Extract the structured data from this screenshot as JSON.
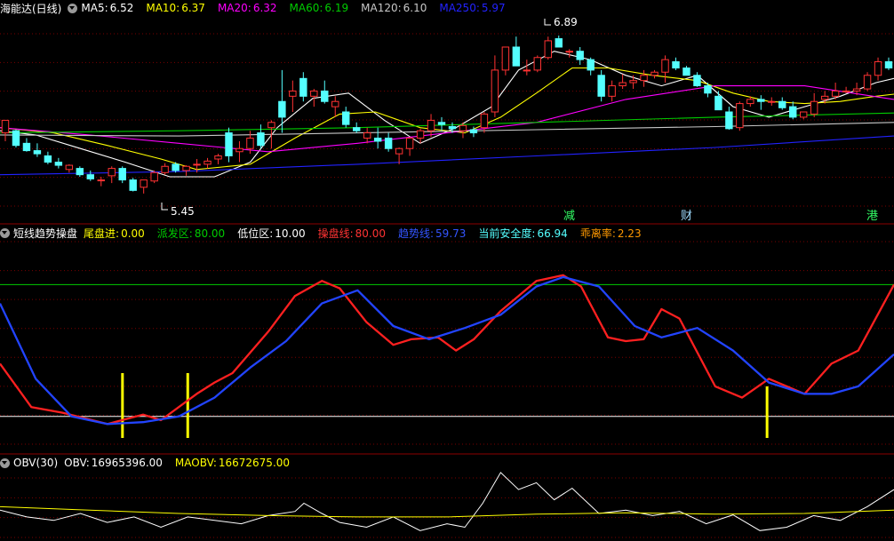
{
  "colors": {
    "white": "#ffffff",
    "yellow": "#ffff00",
    "magenta": "#ff00ff",
    "green": "#00cc00",
    "grey": "#c8c8c8",
    "blue": "#2222ff",
    "up": "#ff3232",
    "down": "#54ffff",
    "red": "#ff2020",
    "trend": "#2244ff",
    "divider": "#8b0000",
    "grid": "#7a0000"
  },
  "panel1": {
    "stock": "海能达(日线)",
    "ma": [
      {
        "label": "MA5:",
        "value": "6.52",
        "color": "#ffffff"
      },
      {
        "label": "MA10:",
        "value": "6.37",
        "color": "#ffff00"
      },
      {
        "label": "MA20:",
        "value": "6.32",
        "color": "#ff00ff"
      },
      {
        "label": "MA60:",
        "value": "6.19",
        "color": "#00cc00"
      },
      {
        "label": "MA120:",
        "value": "6.10",
        "color": "#c8c8c8"
      },
      {
        "label": "MA250:",
        "value": "5.97",
        "color": "#2222ff"
      }
    ],
    "high_label": "6.89",
    "low_label": "5.45",
    "events": [
      {
        "text": "减",
        "color": "#ffffff",
        "bg": "#00aa33"
      },
      {
        "text": "财",
        "color": "#ffffff",
        "bg": "#0044cc"
      },
      {
        "text": "港",
        "color": "#000000",
        "bg": "#00cc33"
      }
    ]
  },
  "panel2": {
    "title": "短线趋势操盘",
    "items": [
      {
        "label": "尾盘进:",
        "value": "0.00",
        "color": "#ffff00"
      },
      {
        "label": "派发区:",
        "value": "80.00",
        "color": "#00cc00"
      },
      {
        "label": "低位区:",
        "value": "10.00",
        "color": "#ffffff"
      },
      {
        "label": "操盘线:",
        "value": "80.00",
        "color": "#ff3333"
      },
      {
        "label": "趋势线:",
        "value": "59.73",
        "color": "#3355ff"
      },
      {
        "label": "当前安全度:",
        "value": "66.94",
        "color": "#54ffff"
      },
      {
        "label": "乖离率:",
        "value": "2.23",
        "color": "#ff9900"
      }
    ]
  },
  "panel3": {
    "title": "OBV(30)",
    "items": [
      {
        "label": "OBV:",
        "value": "16965396.00",
        "color": "#ffffff"
      },
      {
        "label": "MAOBV:",
        "value": "16672675.00",
        "color": "#ffff00"
      }
    ]
  },
  "chart_data": [
    {
      "type": "candlestick",
      "title": "海能达(日线)",
      "ylim": [
        5.3,
        7.1
      ],
      "candles": [
        [
          6.0,
          6.12,
          5.92,
          6.12
        ],
        [
          6.02,
          6.03,
          5.86,
          5.88
        ],
        [
          5.9,
          5.95,
          5.82,
          5.83
        ],
        [
          5.83,
          5.9,
          5.77,
          5.8
        ],
        [
          5.78,
          5.82,
          5.7,
          5.72
        ],
        [
          5.72,
          5.76,
          5.66,
          5.69
        ],
        [
          5.65,
          5.7,
          5.62,
          5.69
        ],
        [
          5.66,
          5.68,
          5.58,
          5.6
        ],
        [
          5.6,
          5.64,
          5.54,
          5.56
        ],
        [
          5.55,
          5.58,
          5.49,
          5.55
        ],
        [
          5.59,
          5.68,
          5.52,
          5.66
        ],
        [
          5.66,
          5.68,
          5.52,
          5.55
        ],
        [
          5.55,
          5.57,
          5.44,
          5.45
        ],
        [
          5.48,
          5.55,
          5.42,
          5.55
        ],
        [
          5.54,
          5.64,
          5.52,
          5.62
        ],
        [
          5.62,
          5.71,
          5.6,
          5.68
        ],
        [
          5.7,
          5.72,
          5.62,
          5.64
        ],
        [
          5.64,
          5.69,
          5.59,
          5.68
        ],
        [
          5.7,
          5.75,
          5.62,
          5.7
        ],
        [
          5.7,
          5.76,
          5.66,
          5.73
        ],
        [
          5.75,
          5.8,
          5.7,
          5.78
        ],
        [
          6.0,
          6.05,
          5.72,
          5.78
        ],
        [
          5.82,
          5.92,
          5.72,
          5.85
        ],
        [
          5.85,
          6.02,
          5.8,
          5.95
        ],
        [
          6.0,
          6.08,
          5.85,
          5.88
        ],
        [
          6.05,
          6.12,
          5.85,
          6.1
        ],
        [
          6.3,
          6.6,
          6.0,
          6.15
        ],
        [
          6.35,
          6.5,
          6.2,
          6.4
        ],
        [
          6.52,
          6.58,
          6.3,
          6.35
        ],
        [
          6.35,
          6.42,
          6.25,
          6.4
        ],
        [
          6.4,
          6.5,
          6.28,
          6.3
        ],
        [
          6.25,
          6.35,
          6.15,
          6.3
        ],
        [
          6.2,
          6.25,
          6.05,
          6.08
        ],
        [
          6.05,
          6.1,
          6.0,
          6.02
        ],
        [
          5.95,
          6.05,
          5.9,
          6.0
        ],
        [
          5.95,
          6.05,
          5.85,
          5.92
        ],
        [
          5.95,
          6.0,
          5.82,
          5.85
        ],
        [
          5.8,
          5.86,
          5.7,
          5.85
        ],
        [
          5.85,
          5.96,
          5.78,
          5.95
        ],
        [
          5.95,
          6.04,
          5.9,
          6.02
        ],
        [
          6.02,
          6.18,
          5.96,
          6.12
        ],
        [
          6.1,
          6.15,
          6.02,
          6.08
        ],
        [
          6.06,
          6.1,
          6.0,
          6.04
        ],
        [
          6.02,
          6.1,
          5.95,
          6.07
        ],
        [
          6.03,
          6.06,
          5.96,
          6.0
        ],
        [
          6.05,
          6.2,
          6.0,
          6.18
        ],
        [
          6.2,
          6.74,
          6.15,
          6.6
        ],
        [
          6.6,
          6.82,
          6.55,
          6.82
        ],
        [
          6.82,
          6.92,
          6.64,
          6.64
        ],
        [
          6.6,
          6.7,
          6.55,
          6.6
        ],
        [
          6.6,
          6.74,
          6.58,
          6.72
        ],
        [
          6.72,
          6.92,
          6.7,
          6.88
        ],
        [
          6.9,
          6.93,
          6.82,
          6.82
        ],
        [
          6.78,
          6.8,
          6.72,
          6.78
        ],
        [
          6.78,
          6.82,
          6.65,
          6.7
        ],
        [
          6.7,
          6.72,
          6.55,
          6.6
        ],
        [
          6.55,
          6.6,
          6.3,
          6.35
        ],
        [
          6.35,
          6.5,
          6.3,
          6.45
        ],
        [
          6.45,
          6.56,
          6.42,
          6.48
        ],
        [
          6.48,
          6.55,
          6.42,
          6.5
        ],
        [
          6.5,
          6.6,
          6.44,
          6.55
        ],
        [
          6.55,
          6.6,
          6.52,
          6.58
        ],
        [
          6.58,
          6.74,
          6.48,
          6.7
        ],
        [
          6.68,
          6.72,
          6.6,
          6.62
        ],
        [
          6.62,
          6.64,
          6.55,
          6.55
        ],
        [
          6.55,
          6.58,
          6.44,
          6.45
        ],
        [
          6.45,
          6.48,
          6.34,
          6.38
        ],
        [
          6.35,
          6.4,
          6.22,
          6.22
        ],
        [
          6.2,
          6.25,
          6.03,
          6.04
        ],
        [
          6.05,
          6.3,
          6.02,
          6.28
        ],
        [
          6.28,
          6.35,
          6.25,
          6.32
        ],
        [
          6.32,
          6.36,
          6.22,
          6.3
        ],
        [
          6.3,
          6.34,
          6.26,
          6.3
        ],
        [
          6.3,
          6.34,
          6.22,
          6.24
        ],
        [
          6.25,
          6.3,
          6.13,
          6.15
        ],
        [
          6.15,
          6.2,
          6.13,
          6.2
        ],
        [
          6.18,
          6.38,
          6.15,
          6.3
        ],
        [
          6.32,
          6.4,
          6.28,
          6.35
        ],
        [
          6.35,
          6.48,
          6.32,
          6.4
        ],
        [
          6.4,
          6.44,
          6.38,
          6.4
        ],
        [
          6.4,
          6.48,
          6.36,
          6.42
        ],
        [
          6.42,
          6.58,
          6.4,
          6.55
        ],
        [
          6.55,
          6.72,
          6.5,
          6.68
        ],
        [
          6.68,
          6.72,
          6.6,
          6.62
        ]
      ],
      "ma_series": [
        {
          "name": "MA5",
          "color": "#ffffff",
          "x": [
            0,
            0.04,
            0.09,
            0.14,
            0.19,
            0.24,
            0.28,
            0.31,
            0.35,
            0.39,
            0.43,
            0.47,
            0.51,
            0.55,
            0.58,
            0.62,
            0.66,
            0.7,
            0.74,
            0.78,
            0.82,
            0.86,
            0.9,
            0.94,
            0.98,
            1.0
          ],
          "y": [
            6.02,
            5.98,
            5.85,
            5.72,
            5.58,
            5.58,
            5.72,
            6.05,
            6.33,
            6.38,
            6.12,
            5.9,
            6.05,
            6.25,
            6.6,
            6.78,
            6.7,
            6.55,
            6.45,
            6.55,
            6.25,
            6.15,
            6.25,
            6.35,
            6.48,
            6.52
          ]
        },
        {
          "name": "MA10",
          "color": "#ffff00",
          "x": [
            0,
            0.06,
            0.12,
            0.18,
            0.22,
            0.28,
            0.33,
            0.38,
            0.42,
            0.47,
            0.52,
            0.56,
            0.6,
            0.64,
            0.68,
            0.73,
            0.78,
            0.82,
            0.86,
            0.9,
            0.94,
            0.98,
            1.0
          ],
          "y": [
            6.05,
            6.0,
            5.88,
            5.75,
            5.65,
            5.7,
            5.95,
            6.18,
            6.2,
            6.05,
            6.0,
            6.15,
            6.38,
            6.62,
            6.62,
            6.55,
            6.5,
            6.38,
            6.3,
            6.28,
            6.3,
            6.35,
            6.37
          ]
        },
        {
          "name": "MA20",
          "color": "#ff00ff",
          "x": [
            0,
            0.1,
            0.2,
            0.3,
            0.4,
            0.5,
            0.6,
            0.7,
            0.8,
            0.9,
            1.0
          ],
          "y": [
            6.05,
            5.98,
            5.9,
            5.82,
            5.9,
            6.0,
            6.1,
            6.32,
            6.45,
            6.45,
            6.32
          ]
        },
        {
          "name": "MA60",
          "color": "#00cc00",
          "x": [
            0,
            0.2,
            0.4,
            0.6,
            0.8,
            1.0
          ],
          "y": [
            6.0,
            6.02,
            6.05,
            6.1,
            6.15,
            6.19
          ]
        },
        {
          "name": "MA120",
          "color": "#c8c8c8",
          "x": [
            0,
            0.2,
            0.4,
            0.6,
            0.8,
            1.0
          ],
          "y": [
            5.98,
            5.97,
            6.0,
            6.03,
            6.06,
            6.1
          ]
        },
        {
          "name": "MA250",
          "color": "#2222ff",
          "x": [
            0,
            0.2,
            0.4,
            0.6,
            0.8,
            1.0
          ],
          "y": [
            5.6,
            5.63,
            5.7,
            5.78,
            5.86,
            5.97
          ]
        }
      ]
    },
    {
      "type": "line",
      "title": "短线趋势操盘",
      "ylim": [
        0,
        100
      ],
      "reference_lines": [
        {
          "name": "派发区",
          "value": 80,
          "color": "#00cc00"
        },
        {
          "name": "低位区",
          "value": 10,
          "color": "#ffffff"
        }
      ],
      "series": [
        {
          "name": "操盘线",
          "color": "#ff2020",
          "x": [
            0,
            0.035,
            0.07,
            0.12,
            0.16,
            0.18,
            0.22,
            0.24,
            0.26,
            0.3,
            0.33,
            0.36,
            0.38,
            0.41,
            0.44,
            0.46,
            0.49,
            0.51,
            0.53,
            0.56,
            0.6,
            0.63,
            0.65,
            0.68,
            0.7,
            0.72,
            0.74,
            0.76,
            0.8,
            0.83,
            0.86,
            0.9,
            0.93,
            0.96,
            1.0
          ],
          "y": [
            38,
            15,
            12,
            6,
            11,
            8,
            22,
            28,
            33,
            55,
            74,
            82,
            78,
            60,
            48,
            51,
            52,
            45,
            51,
            66,
            82,
            85,
            79,
            52,
            50,
            51,
            67,
            62,
            26,
            20,
            30,
            22,
            38,
            45,
            80
          ]
        },
        {
          "name": "趋势线",
          "color": "#2244ff",
          "x": [
            0,
            0.04,
            0.08,
            0.12,
            0.16,
            0.2,
            0.24,
            0.28,
            0.32,
            0.36,
            0.4,
            0.44,
            0.48,
            0.52,
            0.56,
            0.6,
            0.63,
            0.67,
            0.71,
            0.74,
            0.78,
            0.82,
            0.86,
            0.9,
            0.93,
            0.96,
            1.0
          ],
          "y": [
            70,
            30,
            10,
            6,
            7,
            10,
            20,
            36,
            50,
            70,
            77,
            58,
            51,
            57,
            64,
            79,
            84,
            79,
            58,
            52,
            57,
            45,
            28,
            22,
            22,
            26,
            43
          ]
        }
      ],
      "signal_bars": [
        {
          "x": 0.137,
          "value": 33
        },
        {
          "x": 0.21,
          "value": 33
        },
        {
          "x": 0.858,
          "value": 26
        }
      ]
    },
    {
      "type": "line",
      "title": "OBV(30)",
      "series": [
        {
          "name": "OBV",
          "color": "#ffffff",
          "x": [
            0,
            0.03,
            0.06,
            0.09,
            0.12,
            0.15,
            0.18,
            0.21,
            0.24,
            0.27,
            0.3,
            0.33,
            0.34,
            0.36,
            0.38,
            0.41,
            0.44,
            0.47,
            0.5,
            0.52,
            0.54,
            0.56,
            0.58,
            0.6,
            0.62,
            0.64,
            0.67,
            0.7,
            0.73,
            0.76,
            0.79,
            0.82,
            0.85,
            0.88,
            0.91,
            0.94,
            0.97,
            1.0
          ],
          "y": [
            0.4,
            0.3,
            0.25,
            0.35,
            0.22,
            0.3,
            0.15,
            0.3,
            0.25,
            0.2,
            0.32,
            0.38,
            0.5,
            0.35,
            0.22,
            0.15,
            0.3,
            0.1,
            0.2,
            0.15,
            0.5,
            0.95,
            0.7,
            0.8,
            0.55,
            0.72,
            0.35,
            0.4,
            0.32,
            0.38,
            0.2,
            0.33,
            0.1,
            0.15,
            0.32,
            0.25,
            0.45,
            0.7
          ]
        },
        {
          "name": "MAOBV",
          "color": "#ffff00",
          "x": [
            0,
            0.1,
            0.2,
            0.3,
            0.4,
            0.5,
            0.6,
            0.7,
            0.8,
            0.9,
            1.0
          ],
          "y": [
            0.45,
            0.4,
            0.35,
            0.32,
            0.3,
            0.3,
            0.34,
            0.36,
            0.34,
            0.35,
            0.4
          ]
        }
      ]
    }
  ]
}
